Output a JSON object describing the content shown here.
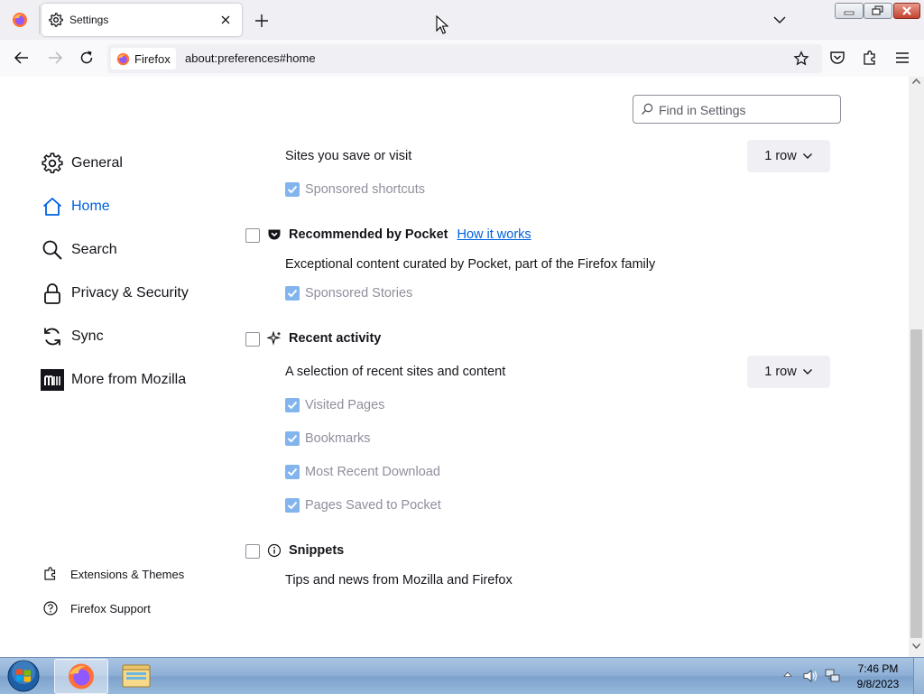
{
  "browser": {
    "tab": {
      "title": "Settings",
      "icon": "gear-icon"
    },
    "url": {
      "identity_label": "Firefox",
      "address": "about:preferences#home"
    }
  },
  "settings": {
    "search": {
      "placeholder": "Find in Settings",
      "value": ""
    },
    "categories": [
      {
        "label": "General",
        "icon": "gear-icon",
        "selected": false
      },
      {
        "label": "Home",
        "icon": "home-icon",
        "selected": true
      },
      {
        "label": "Search",
        "icon": "search-icon",
        "selected": false
      },
      {
        "label": "Privacy & Security",
        "icon": "lock-icon",
        "selected": false
      },
      {
        "label": "Sync",
        "icon": "sync-icon",
        "selected": false
      },
      {
        "label": "More from Mozilla",
        "icon": "mozilla-icon",
        "selected": false
      }
    ],
    "footer": [
      {
        "label": "Extensions & Themes",
        "icon": "puzzle-icon"
      },
      {
        "label": "Firefox Support",
        "icon": "help-icon"
      }
    ],
    "shortcuts": {
      "description": "Sites you save or visit",
      "rows_value": "1 row",
      "sponsored_label": "Sponsored shortcuts",
      "sponsored_checked": true
    },
    "pocket": {
      "title": "Recommended by Pocket",
      "link": "How it works",
      "checked": false,
      "description": "Exceptional content curated by Pocket, part of the Firefox family",
      "sponsored_label": "Sponsored Stories",
      "sponsored_checked": true
    },
    "recent": {
      "title": "Recent activity",
      "checked": false,
      "description": "A selection of recent sites and content",
      "rows_value": "1 row",
      "options": [
        {
          "label": "Visited Pages",
          "checked": true
        },
        {
          "label": "Bookmarks",
          "checked": true
        },
        {
          "label": "Most Recent Download",
          "checked": true
        },
        {
          "label": "Pages Saved to Pocket",
          "checked": true
        }
      ]
    },
    "snippets": {
      "title": "Snippets",
      "checked": false,
      "description": "Tips and news from Mozilla and Firefox"
    }
  },
  "taskbar": {
    "time": "7:46 PM",
    "date": "9/8/2023"
  }
}
